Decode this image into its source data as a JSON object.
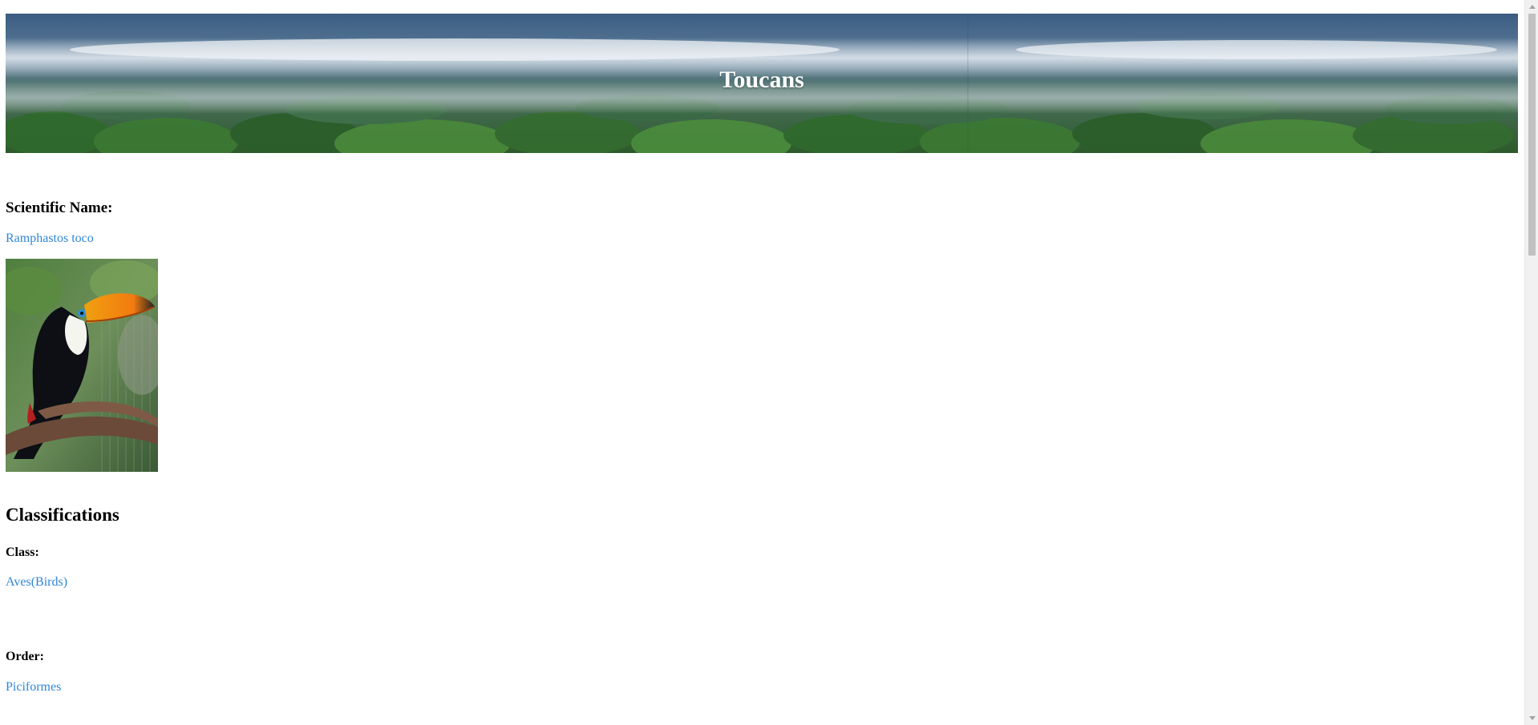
{
  "banner": {
    "title": "Toucans"
  },
  "scientific_name": {
    "label": "Scientific Name:",
    "value": "Ramphastos toco"
  },
  "classifications": {
    "heading": "Classifications",
    "class": {
      "label": "Class:",
      "value": "Aves(Birds)"
    },
    "order": {
      "label": "Order:",
      "value": "Piciformes"
    }
  },
  "colors": {
    "link": "#2f86d8",
    "banner_text": "#ffffff"
  }
}
